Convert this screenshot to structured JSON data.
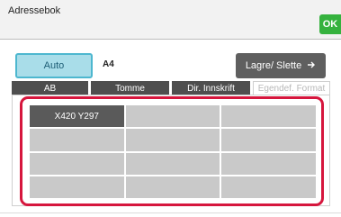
{
  "window": {
    "title": "Adressebok",
    "ok_label": "OK"
  },
  "controls": {
    "auto_label": "Auto",
    "size_value": "A4",
    "save_delete_label": "Lagre/ Slette",
    "save_delete_icon": "arrow-right-icon"
  },
  "tabs": [
    {
      "label": "AB",
      "active": false
    },
    {
      "label": "Tomme",
      "active": false
    },
    {
      "label": "Dir. Innskrift",
      "active": false
    },
    {
      "label": "Egendef. Format",
      "active": true
    }
  ],
  "grid_cells": [
    {
      "label": "X420 Y297",
      "filled": true
    },
    {
      "label": "",
      "filled": false
    },
    {
      "label": "",
      "filled": false
    },
    {
      "label": "",
      "filled": false
    },
    {
      "label": "",
      "filled": false
    },
    {
      "label": "",
      "filled": false
    },
    {
      "label": "",
      "filled": false
    },
    {
      "label": "",
      "filled": false
    },
    {
      "label": "",
      "filled": false
    },
    {
      "label": "",
      "filled": false
    },
    {
      "label": "",
      "filled": false
    },
    {
      "label": "",
      "filled": false
    }
  ],
  "colors": {
    "ok_green": "#35b23e",
    "auto_blue": "#a9dde9",
    "highlight_red": "#d6163d",
    "dark_button": "#5f5f5f"
  }
}
